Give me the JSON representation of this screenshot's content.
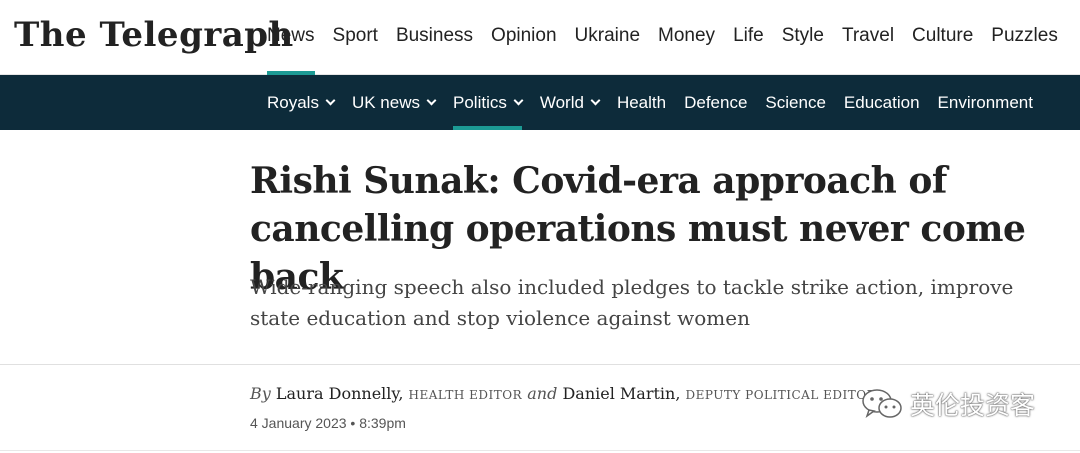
{
  "brand": {
    "logo_text": "The Telegraph"
  },
  "main_nav": {
    "items": [
      {
        "label": "News",
        "active": true
      },
      {
        "label": "Sport"
      },
      {
        "label": "Business"
      },
      {
        "label": "Opinion"
      },
      {
        "label": "Ukraine"
      },
      {
        "label": "Money"
      },
      {
        "label": "Life"
      },
      {
        "label": "Style"
      },
      {
        "label": "Travel"
      },
      {
        "label": "Culture"
      },
      {
        "label": "Puzzles"
      }
    ]
  },
  "sub_nav": {
    "items": [
      {
        "label": "Royals",
        "dropdown": true
      },
      {
        "label": "UK news",
        "dropdown": true
      },
      {
        "label": "Politics",
        "dropdown": true,
        "active": true
      },
      {
        "label": "World",
        "dropdown": true
      },
      {
        "label": "Health"
      },
      {
        "label": "Defence"
      },
      {
        "label": "Science"
      },
      {
        "label": "Education"
      },
      {
        "label": "Environment"
      }
    ]
  },
  "article": {
    "headline": "Rishi Sunak: Covid-era approach of cancelling operations must never come back",
    "standfirst": "Wide-ranging speech also included pledges to tackle strike action, improve state education and stop violence against women",
    "byline": {
      "by": "By",
      "author1": "Laura Donnelly,",
      "role1": "HEALTH EDITOR",
      "and": "and",
      "author2": "Daniel Martin,",
      "role2": "DEPUTY POLITICAL EDITOR"
    },
    "dateline": "4 January 2023 • 8:39pm"
  },
  "watermark": {
    "text": "英伦投资客",
    "icon": "wechat-icon"
  },
  "colors": {
    "accent": "#1c9a94",
    "subnav_bg": "#0d2b3a",
    "text": "#222222"
  }
}
